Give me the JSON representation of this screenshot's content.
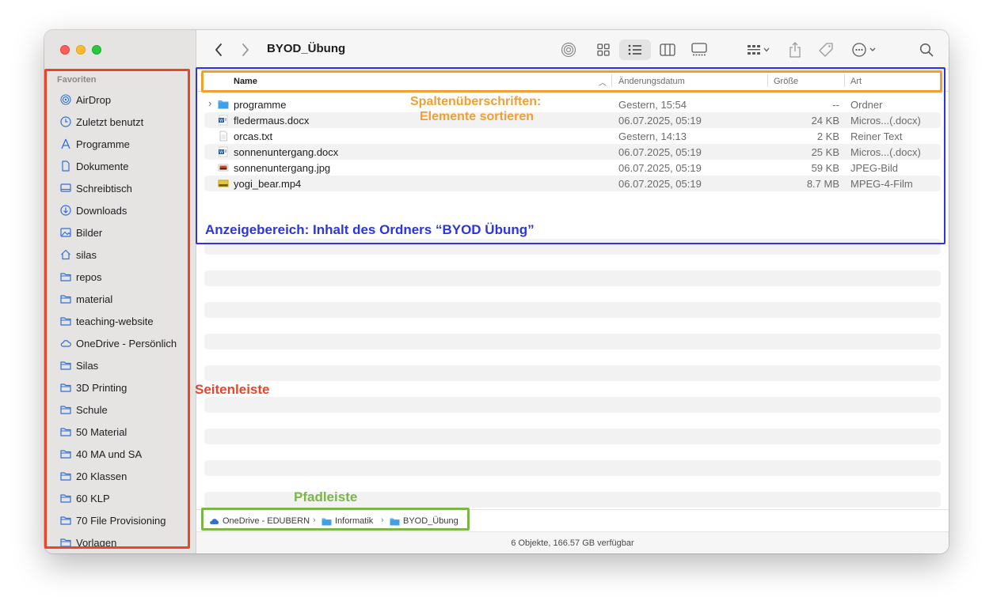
{
  "window": {
    "title": "BYOD_Übung",
    "status": "6 Objekte, 166.57 GB verfügbar"
  },
  "sidebar": {
    "section": "Favoriten",
    "items": [
      {
        "label": "AirDrop",
        "icon": "airdrop-icon"
      },
      {
        "label": "Zuletzt benutzt",
        "icon": "clock-icon"
      },
      {
        "label": "Programme",
        "icon": "apps-icon"
      },
      {
        "label": "Dokumente",
        "icon": "document-icon"
      },
      {
        "label": "Schreibtisch",
        "icon": "desktop-icon"
      },
      {
        "label": "Downloads",
        "icon": "download-icon"
      },
      {
        "label": "Bilder",
        "icon": "photo-icon"
      },
      {
        "label": "silas",
        "icon": "home-icon"
      },
      {
        "label": "repos",
        "icon": "folder-icon"
      },
      {
        "label": "material",
        "icon": "folder-icon"
      },
      {
        "label": "teaching-website",
        "icon": "folder-icon"
      },
      {
        "label": "OneDrive - Persönlich",
        "icon": "cloud-icon"
      },
      {
        "label": "Silas",
        "icon": "folder-icon"
      },
      {
        "label": "3D Printing",
        "icon": "folder-icon"
      },
      {
        "label": "Schule",
        "icon": "folder-icon"
      },
      {
        "label": "50 Material",
        "icon": "folder-icon"
      },
      {
        "label": "40 MA und SA",
        "icon": "folder-icon"
      },
      {
        "label": "20 Klassen",
        "icon": "folder-icon"
      },
      {
        "label": "60 KLP",
        "icon": "folder-icon"
      },
      {
        "label": "70 File Provisioning",
        "icon": "folder-icon"
      },
      {
        "label": "Vorlagen",
        "icon": "folder-icon"
      }
    ]
  },
  "columns": {
    "name": "Name",
    "date": "Änderungsdatum",
    "size": "Größe",
    "kind": "Art"
  },
  "files": [
    {
      "name": "programme",
      "date": "Gestern, 15:54",
      "size": "--",
      "kind": "Ordner",
      "icon": "folder-icon"
    },
    {
      "name": "fledermaus.docx",
      "date": "06.07.2025, 05:19",
      "size": "24 KB",
      "kind": "Micros...(.docx)",
      "icon": "word-doc-icon"
    },
    {
      "name": "orcas.txt",
      "date": "Gestern, 14:13",
      "size": "2 KB",
      "kind": "Reiner Text",
      "icon": "text-file-icon"
    },
    {
      "name": "sonnenuntergang.docx",
      "date": "06.07.2025, 05:19",
      "size": "25 KB",
      "kind": "Micros...(.docx)",
      "icon": "word-doc-icon"
    },
    {
      "name": "sonnenuntergang.jpg",
      "date": "06.07.2025, 05:19",
      "size": "59 KB",
      "kind": "JPEG-Bild",
      "icon": "image-file-icon"
    },
    {
      "name": "yogi_bear.mp4",
      "date": "06.07.2025, 05:19",
      "size": "8.7 MB",
      "kind": "MPEG-4-Film",
      "icon": "video-file-icon"
    }
  ],
  "pathbar": [
    "OneDrive - EDUBERN",
    "Informatik",
    "BYOD_Übung"
  ],
  "annotations": {
    "sidebar": "Seitenleiste",
    "headers_line1": "Spaltenüberschriften:",
    "headers_line2": "Elemente sortieren",
    "display_area": "Anzeigebereich: Inhalt des Ordners “BYOD Übung”",
    "pathbar": "Pfadleiste"
  },
  "colors": {
    "annotation_red": "#e8452b",
    "annotation_orange": "#f0a030",
    "annotation_blue": "#2b35e0",
    "annotation_green": "#7ab648",
    "accent": "#2f6fd8"
  }
}
